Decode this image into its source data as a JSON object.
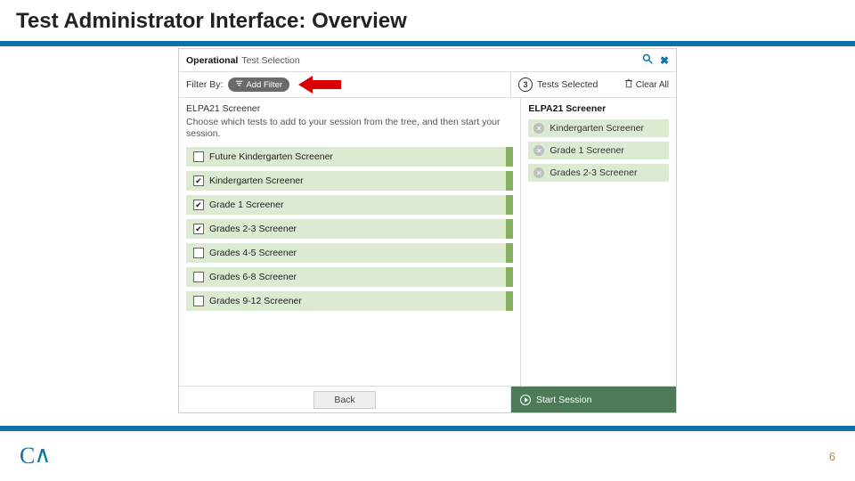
{
  "title": "Test Administrator Interface: Overview",
  "header": {
    "strong": "Operational",
    "sub": "Test Selection"
  },
  "filter": {
    "label": "Filter By:",
    "button": "Add Filter"
  },
  "selected": {
    "count": "3",
    "label": "Tests Selected",
    "clear": "Clear All"
  },
  "group": {
    "title": "ELPA21 Screener",
    "desc": "Choose which tests to add to your session from the tree, and then start your session."
  },
  "tests": [
    {
      "label": "Future Kindergarten Screener",
      "checked": false
    },
    {
      "label": "Kindergarten Screener",
      "checked": true
    },
    {
      "label": "Grade 1 Screener",
      "checked": true
    },
    {
      "label": "Grades 2-3 Screener",
      "checked": true
    },
    {
      "label": "Grades 4-5 Screener",
      "checked": false
    },
    {
      "label": "Grades 6-8 Screener",
      "checked": false
    },
    {
      "label": "Grades 9-12 Screener",
      "checked": false
    }
  ],
  "right_group_title": "ELPA21 Screener",
  "selected_items": [
    {
      "label": "Kindergarten Screener"
    },
    {
      "label": "Grade 1 Screener"
    },
    {
      "label": "Grades 2-3 Screener"
    }
  ],
  "footer": {
    "back": "Back",
    "start": "Start Session"
  },
  "page_number": "6",
  "logo": "CA"
}
